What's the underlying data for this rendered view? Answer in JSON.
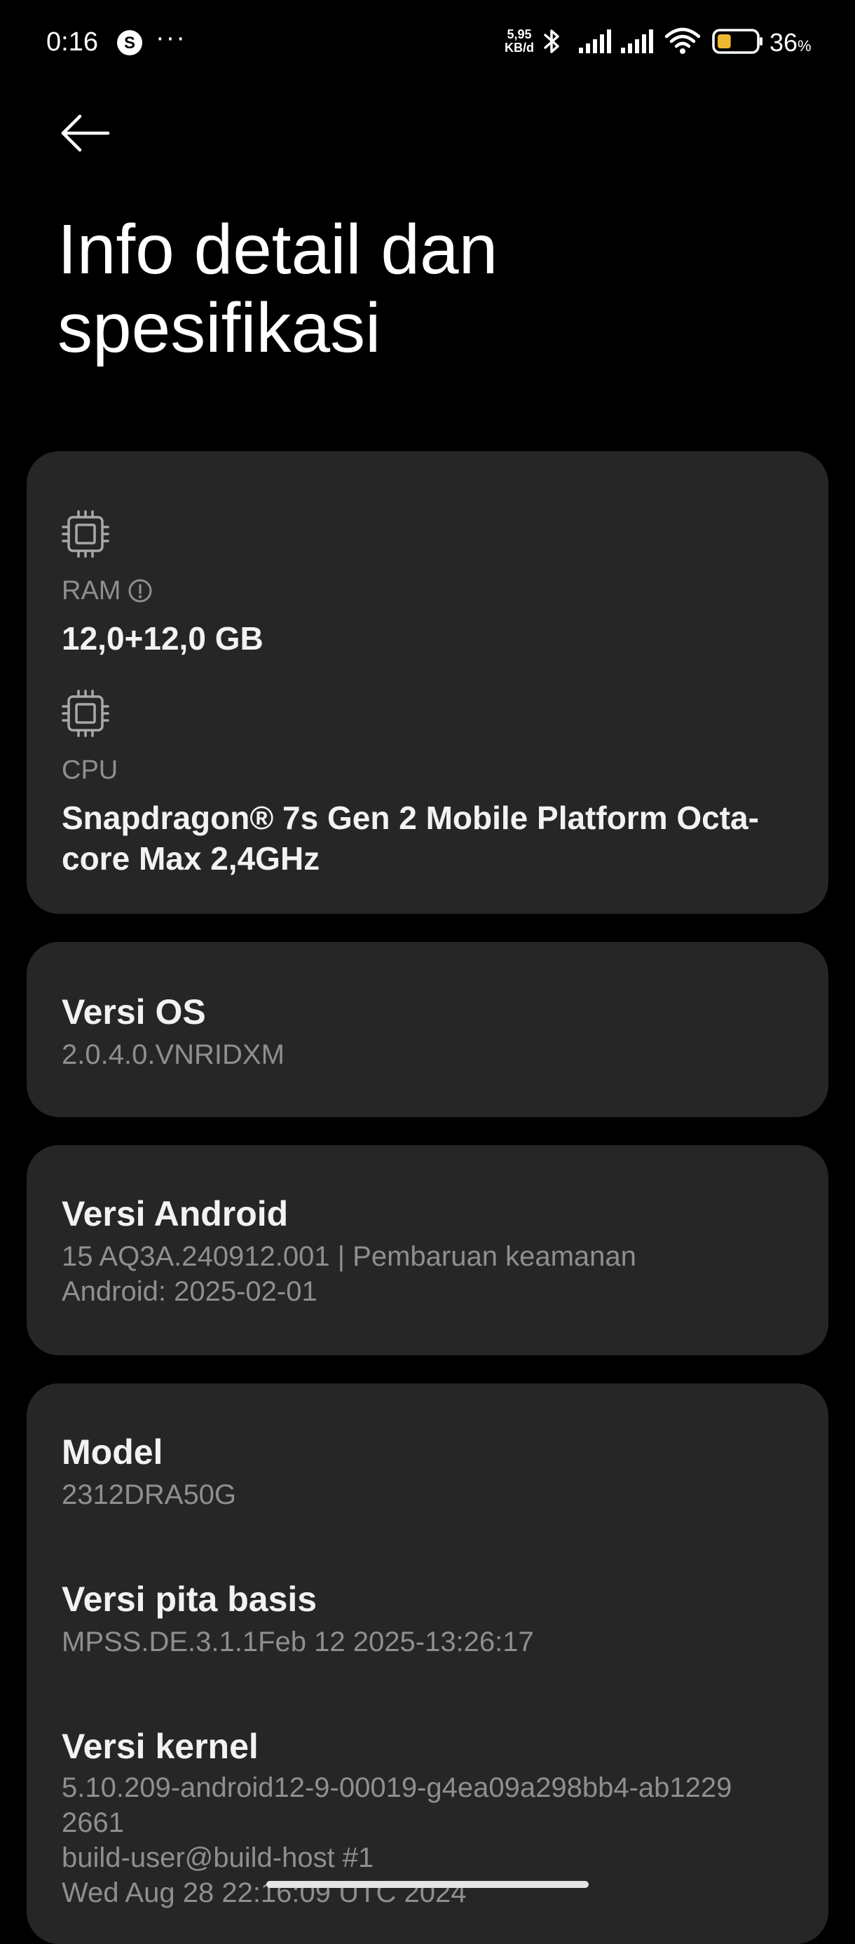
{
  "status_bar": {
    "time": "0:16",
    "more": "···",
    "net_speed_value": "5,95",
    "net_speed_unit": "KB/d",
    "battery_percent": "36",
    "battery_percent_sign": "%",
    "battery_level": 36,
    "icons": [
      "app-s-icon",
      "bluetooth-icon",
      "signal-icon",
      "signal-icon",
      "wifi-icon",
      "battery-icon"
    ]
  },
  "header": {
    "title": "Info detail dan spesifikasi"
  },
  "specs": {
    "ram_label": "RAM",
    "ram_value": "12,0+12,0 GB",
    "cpu_label": "CPU",
    "cpu_value": "Snapdragon® 7s Gen 2 Mobile Platform Octa-core Max 2,4GHz"
  },
  "os": {
    "title": "Versi OS",
    "value": "2.0.4.0.VNRIDXM"
  },
  "android": {
    "title": "Versi Android",
    "value": "15 AQ3A.240912.001 | Pembaruan keamanan\nAndroid: 2025-02-01"
  },
  "model": {
    "title": "Model",
    "value": "2312DRA50G"
  },
  "baseband": {
    "title": "Versi pita basis",
    "value": "MPSS.DE.3.1.1Feb 12 2025-13:26:17"
  },
  "kernel": {
    "title": "Versi kernel",
    "value": "5.10.209-android12-9-00019-g4ea09a298bb4-ab1229\n2661\nbuild-user@build-host #1\nWed Aug 28 22:16:09 UTC 2024"
  }
}
